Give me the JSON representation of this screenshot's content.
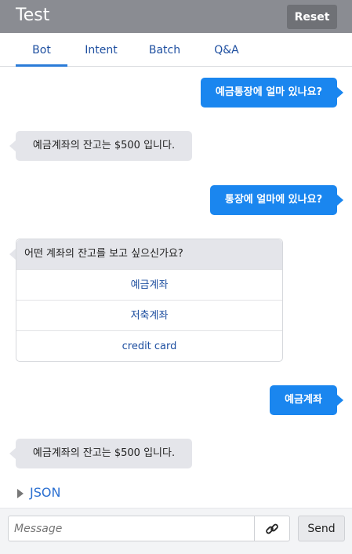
{
  "header": {
    "title": "Test",
    "reset_label": "Reset"
  },
  "tabs": [
    {
      "label": "Bot",
      "active": true
    },
    {
      "label": "Intent",
      "active": false
    },
    {
      "label": "Batch",
      "active": false
    },
    {
      "label": "Q&A",
      "active": false
    }
  ],
  "conversation": {
    "user_1": "예금통장에 얼마 있나요?",
    "bot_1": "예금계좌의 잔고는 $500 입니다.",
    "user_2": "통장에 얼마에 있나요?",
    "bot_question": "어떤 계좌의 잔고를 보고 싶으신가요?",
    "options": [
      "예금계좌",
      "저축계좌",
      "credit card"
    ],
    "user_3": "예금계좌",
    "bot_2": "예금계좌의 잔고는 $500 입니다."
  },
  "json_toggle": {
    "label": "JSON"
  },
  "composer": {
    "placeholder": "Message",
    "send_label": "Send",
    "link_icon": "link-icon"
  },
  "colors": {
    "user_bubble": "#1a86ef",
    "bot_bubble": "#e4e5ea",
    "header": "#8a8c92",
    "tab_active": "#2a7bd8",
    "link": "#1e4fa0"
  }
}
